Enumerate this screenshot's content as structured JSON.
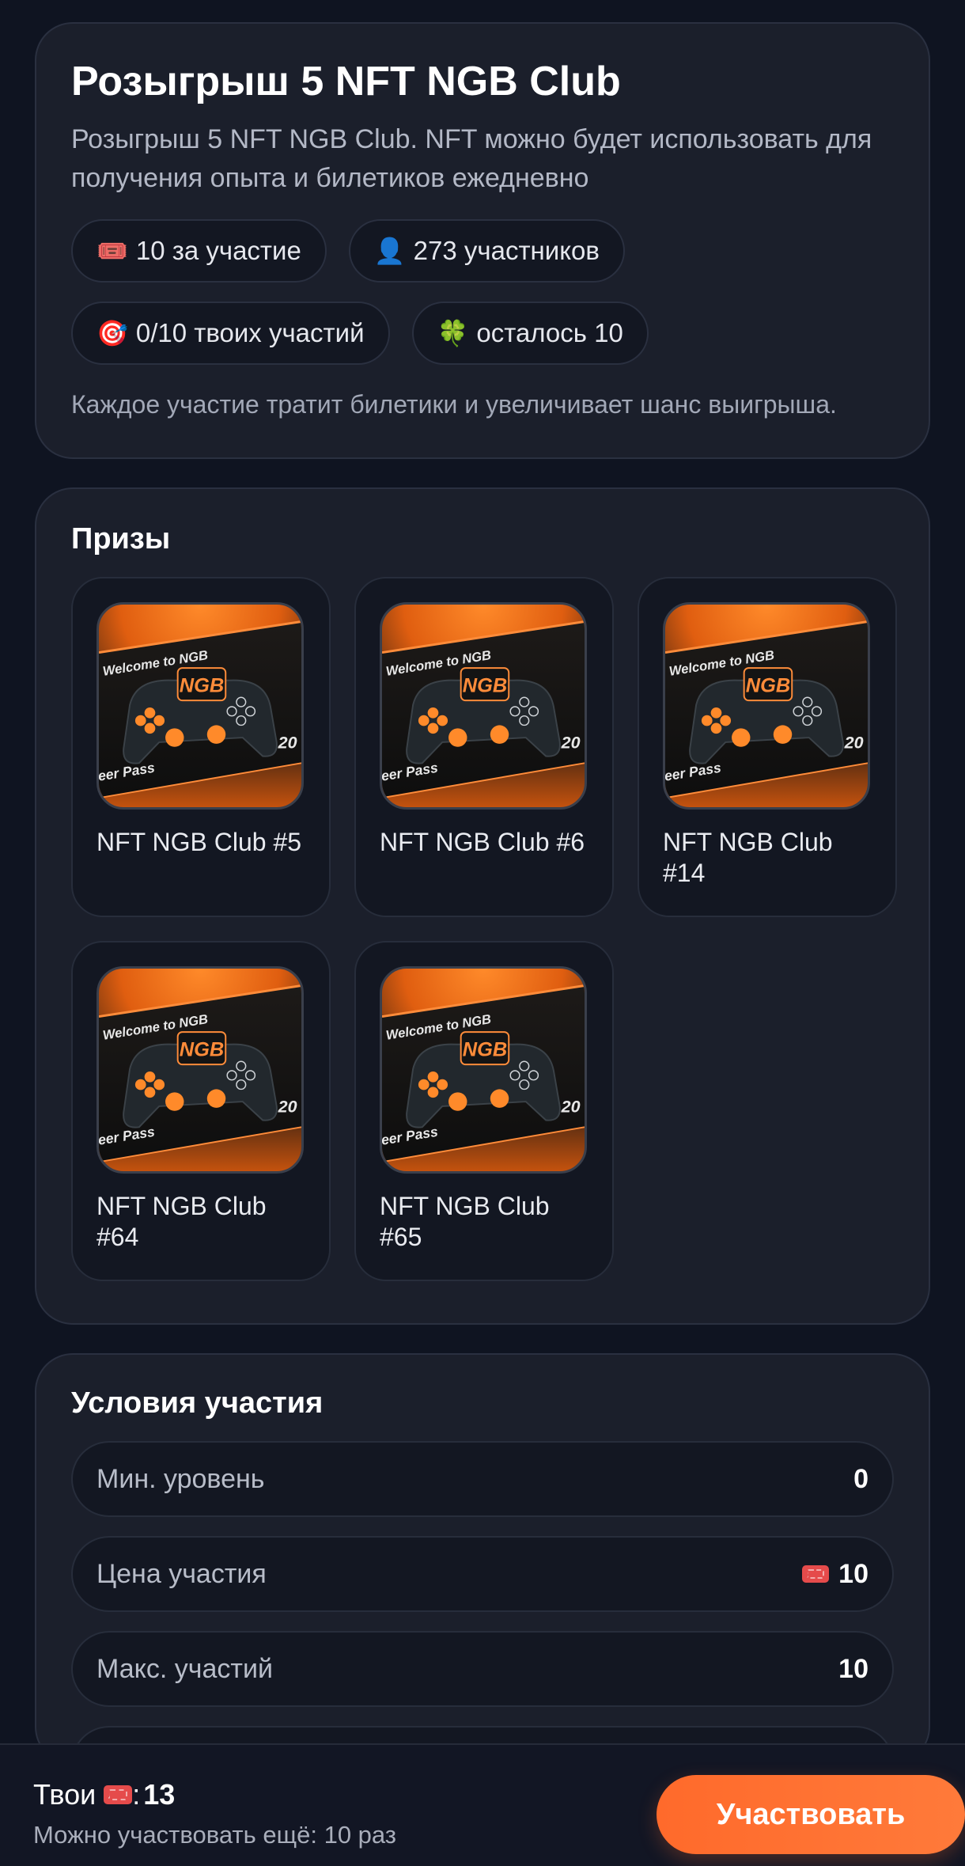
{
  "header": {
    "title": "Розыгрыш 5 NFT NGB Club",
    "description": "Розыгрыш 5 NFT NGB Club. NFT можно будет использовать для получения опыта и билетиков ежедневно",
    "chips": [
      {
        "icon": "ticket-icon",
        "glyph": "🎟️",
        "label": "10 за участие"
      },
      {
        "icon": "user-icon",
        "glyph": "👤",
        "label": "273 участников"
      },
      {
        "icon": "target-icon",
        "glyph": "🎯",
        "label": "0/10 твоих участий"
      },
      {
        "icon": "clover-icon",
        "glyph": "🍀",
        "label": "осталось 10"
      }
    ],
    "note": "Каждое участие тратит билетики и увеличивает шанс выигрыша."
  },
  "prizes": {
    "title": "Призы",
    "image_text": {
      "welcome": "Welcome to NGB",
      "logo": "NGB",
      "year": "20",
      "pass": "eer Pass"
    },
    "items": [
      {
        "name": "NFT NGB Club #5"
      },
      {
        "name": "NFT NGB Club #6"
      },
      {
        "name": "NFT NGB Club #14"
      },
      {
        "name": "NFT NGB Club #64"
      },
      {
        "name": "NFT NGB Club #65"
      }
    ]
  },
  "conditions": {
    "title": "Условия участия",
    "rows": [
      {
        "label": "Мин. уровень",
        "value": "0",
        "icon": ""
      },
      {
        "label": "Цена участия",
        "value": "10",
        "icon": "ticket-icon"
      },
      {
        "label": "Макс. участий",
        "value": "10",
        "icon": ""
      }
    ]
  },
  "bottom": {
    "balance_label": "Твои",
    "balance_suffix": ":",
    "balance_value": "13",
    "can_join_text": "Можно участвовать ещё: 10 раз",
    "join_button": "Участвовать"
  },
  "colors": {
    "accent": "#ff6a2b",
    "ticket": "#e54b4b",
    "background": "#0f1421",
    "card": "#1b1f2b"
  }
}
